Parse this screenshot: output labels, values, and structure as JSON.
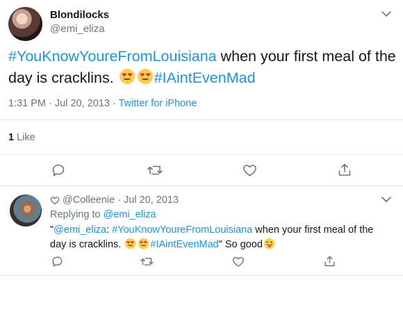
{
  "tweet": {
    "display_name": "Blondilocks",
    "handle": "@emi_eliza",
    "hashtag_1": "#YouKnowYoureFromLouisiana",
    "text_part": " when your first meal of the day is cracklins. ",
    "hashtag_2": "#IAintEvenMad",
    "timestamp": "1:31 PM · Jul 20, 2013",
    "separator": " · ",
    "source": "Twitter for iPhone",
    "like_count": "1",
    "like_label": " Like"
  },
  "reply": {
    "handle": "@Colleenie",
    "date": "· Jul 20, 2013",
    "replying_prefix": "Replying to ",
    "replying_to": "@emi_eliza",
    "quote_open": "\"",
    "quoted_handle": "@emi_eliza",
    "colon": ": ",
    "hashtag_1": "#YouKnowYoureFromLouisiana",
    "text_part": " when your first meal of the day is cracklins. ",
    "hashtag_2": "#IAintEvenMad",
    "quote_close": "\" So good"
  },
  "icons": {
    "action_color": "#657786",
    "link_color": "#1b95e0",
    "emoji_face": "smiling-face-with-heart-eyes",
    "emoji_tongue": "face-with-tongue"
  }
}
